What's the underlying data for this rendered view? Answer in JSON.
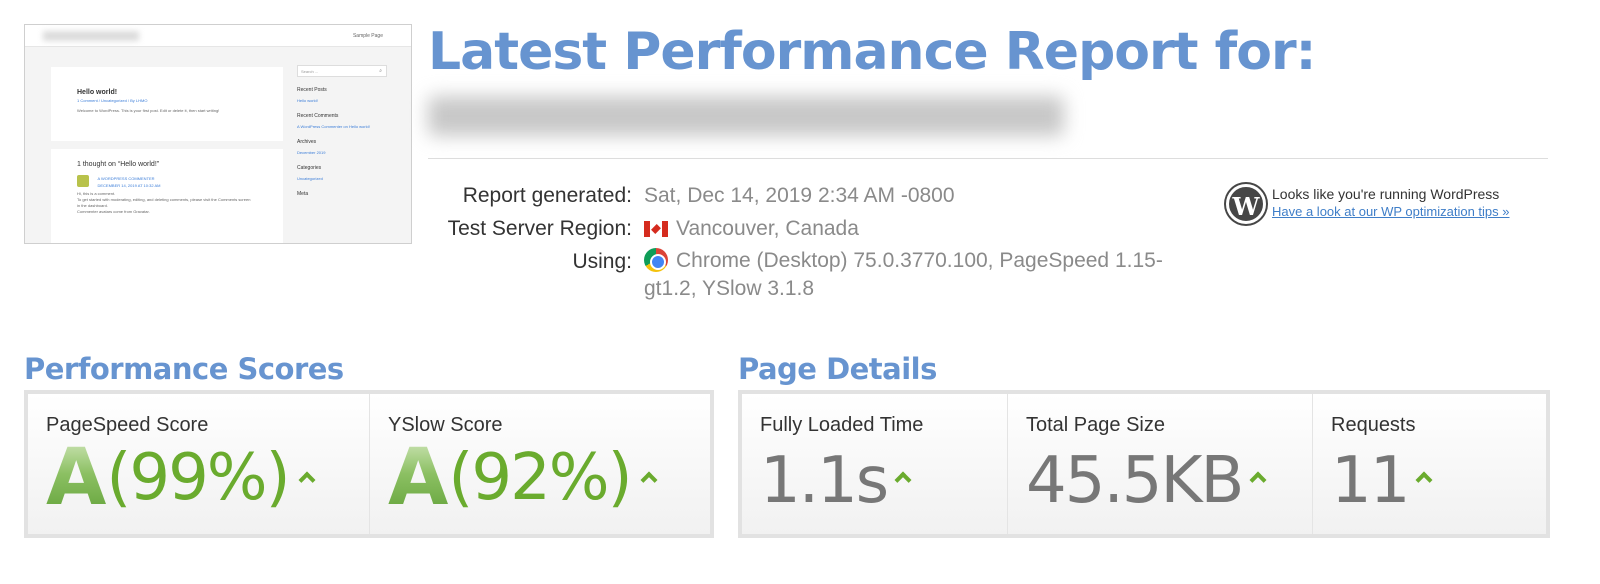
{
  "thumbnail": {
    "nav_link": "Sample Page",
    "post_title": "Hello world!",
    "post_meta": "1 Comment / Uncategorized / By LHMO",
    "post_body": "Welcome to WordPress. This is your first post. Edit or delete it, then start writing!",
    "comments_title": "1 thought on “Hello world!”",
    "commenter": "A WORDPRESS COMMENTER",
    "comment_date": "DECEMBER 14, 2019 AT 10:32 AM",
    "comment_line1": "Hi, this is a comment.",
    "comment_line2": "To get started with moderating, editing, and deleting comments, please visit the Comments screen",
    "comment_line3": "in the dashboard.",
    "comment_line4": "Commenter avatars come from Gravatar.",
    "search_placeholder": "Search ...",
    "sidebar": [
      {
        "heading": "Recent Posts",
        "link": "Hello world!"
      },
      {
        "heading": "Recent Comments",
        "link": "A WordPress Commenter on Hello world!"
      },
      {
        "heading": "Archives",
        "link": "December 2019"
      },
      {
        "heading": "Categories",
        "link": "Uncategorized"
      },
      {
        "heading": "Meta",
        "link": ""
      }
    ]
  },
  "header": {
    "title": "Latest Performance Report for:"
  },
  "info": {
    "report_generated_label": "Report generated:",
    "report_generated_value": "Sat, Dec 14, 2019 2:34 AM -0800",
    "region_label": "Test Server Region:",
    "region_value": "Vancouver, Canada",
    "region_icon": "canada-flag-icon",
    "using_label": "Using:",
    "using_value": "Chrome (Desktop) 75.0.3770.100, PageSpeed 1.15-gt1.2, YSlow 3.1.8",
    "using_icon": "chrome-icon"
  },
  "wordpress": {
    "text": "Looks like you're running WordPress",
    "link": "Have a look at our WP optimization tips »",
    "icon": "wordpress-logo-icon"
  },
  "performance": {
    "title": "Performance Scores",
    "pagespeed_label": "PageSpeed Score",
    "pagespeed_grade": "A",
    "pagespeed_pct": "(99%)",
    "yslow_label": "YSlow Score",
    "yslow_grade": "A",
    "yslow_pct": "(92%)"
  },
  "details": {
    "title": "Page Details",
    "load_label": "Fully Loaded Time",
    "load_value": "1.1s",
    "size_label": "Total Page Size",
    "size_value": "45.5KB",
    "requests_label": "Requests",
    "requests_value": "11"
  },
  "colors": {
    "accent_blue": "#6794d0",
    "grade_green": "#6aab2e",
    "link_blue": "#3f7ec8"
  }
}
